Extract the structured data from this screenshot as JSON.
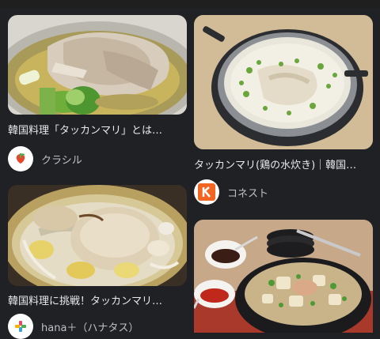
{
  "results": [
    {
      "caption": "韓国料理「タッカンマリ」とは…",
      "source_name": "クラシル",
      "source_icon": "kurashiru-logo-icon",
      "image": "chicken-soup-pot-image"
    },
    {
      "caption": "タッカンマリ(鶏の水炊き)｜韓国…",
      "source_name": "コネスト",
      "source_icon": "konest-logo-icon",
      "image": "chicken-broth-pot-image"
    },
    {
      "caption": "韓国料理に挑戦！タッカンマリ…",
      "source_name": "hana＋（ハナタス）",
      "source_icon": "hanatasu-logo-icon",
      "image": "whole-chicken-pot-image"
    },
    {
      "caption": "",
      "source_name": "",
      "source_icon": "",
      "image": "chicken-stew-table-image"
    }
  ],
  "colors": {
    "background": "#202124",
    "text": "#e8eaed",
    "secondary_text": "#bdc1c6",
    "konest_orange": "#f26522",
    "kurashiru_red": "#e8452c"
  }
}
